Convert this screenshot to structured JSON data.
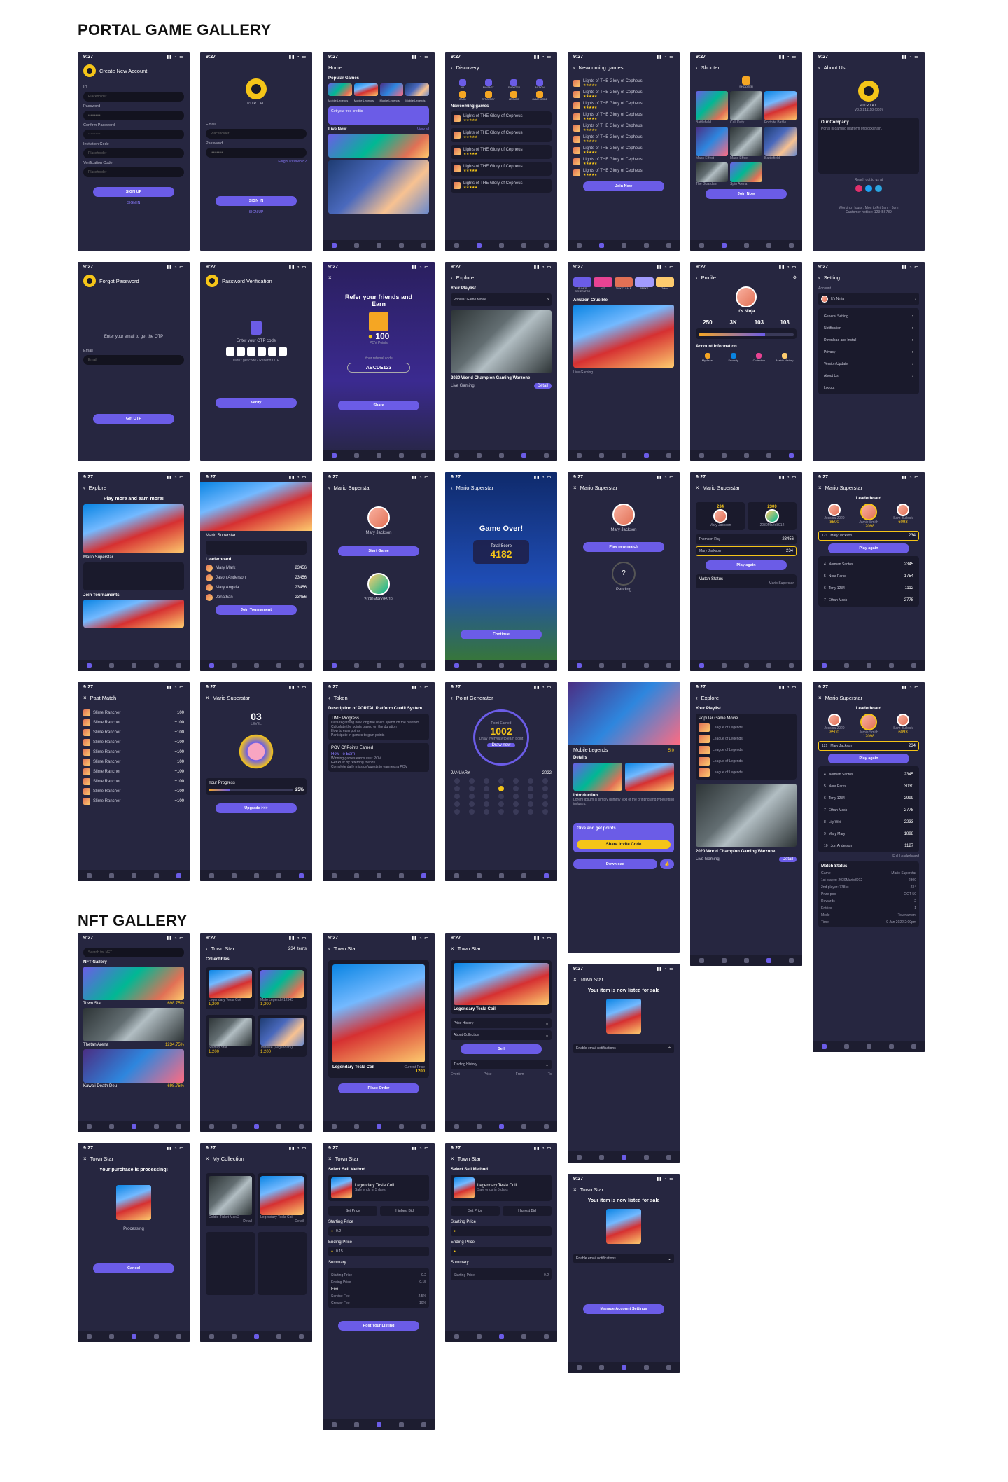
{
  "sections": {
    "game": "PORTAL GAME GALLERY",
    "nft": "NFT GALLERY"
  },
  "status": {
    "time": "9:27"
  },
  "common": {
    "portal": "PORTAL",
    "email": "Email",
    "password": "Password",
    "placeholder": "Placeholder",
    "sign_in": "SIGN IN",
    "sign_up": "SIGN UP",
    "join_now": "Join Now",
    "share": "Share"
  },
  "create_account": {
    "title": "Create New Account",
    "fields": [
      "ID",
      "Password",
      "Confirm Password",
      "Invitation Code",
      "Verification Code"
    ],
    "button": "SIGN UP",
    "link": "SIGN IN"
  },
  "login": {
    "forgot": "Forgot Password?",
    "button": "SIGN IN",
    "link": "SIGN UP"
  },
  "home": {
    "title": "Home",
    "popular": "Popular Games",
    "games": [
      "Mobile Legends",
      "Mobile Legends",
      "Mobile Legends",
      "Mobile Legends"
    ],
    "credits": "Get your free credits",
    "live": "Live Now",
    "view_all": "View all"
  },
  "discovery": {
    "title": "Discovery",
    "cats": [
      "ALL",
      "FANTASY",
      "SHOOTER",
      "ACTION",
      "CARD",
      "STRATEGY",
      "LEISURE",
      "GAME MODE"
    ],
    "newcoming": "Newcoming games",
    "game": "Lights of THE Glory of Cepheus"
  },
  "newcoming": {
    "title": "Newcoming games",
    "button": "Join Now"
  },
  "shooter": {
    "title": "Shooter",
    "label": "SHOOTER",
    "tiles": [
      "Battlefield",
      "Call Duty",
      "Fortnite Battle",
      "Mass Effect",
      "Mass Effect",
      "Battlefield",
      "The Guardian",
      "Spin Arena"
    ],
    "button": "Join Now"
  },
  "about": {
    "title": "About Us",
    "version": "V3.0.211118 (369)",
    "company": "Our Company",
    "reach": "Reach out to us at",
    "hours": "Working Hours : Mon to Fri  9am - 6pm",
    "hotline": "Customer hotline: 123456789"
  },
  "forgot": {
    "title": "Forgot Password",
    "text": "Enter your email to get the OTP",
    "button": "Get OTP"
  },
  "verify": {
    "title": "Password Verification",
    "text": "Enter your OTP code",
    "resend": "Didn't get code? Resend OTP",
    "button": "Verify"
  },
  "refer": {
    "title": "Refer your friends and Earn",
    "points": "100",
    "unit": "POV Points",
    "referral": "Your referral code",
    "code": "ABCDE123",
    "button": "Share"
  },
  "explore_a": {
    "title": "Explore",
    "playlist": "Your Playlist",
    "movie": "Popular Game Movie",
    "video": "2020 World Champion Gaming Warzone",
    "live": "Live Gaming",
    "detail": "Detail"
  },
  "portfolio": {
    "apps": [
      "PUNKS GENERATOR",
      "NFT",
      "TICKET SALE",
      "PERKS",
      "Token"
    ],
    "featured": "Amazon Crucible",
    "live": "Live Gaming"
  },
  "profile": {
    "title": "Profile",
    "name": "It's Ninja",
    "stats": [
      "250",
      "3K",
      "103",
      "103"
    ],
    "account": "Account Information",
    "items": [
      "My Asset",
      "Security",
      "Collection",
      "Match History"
    ]
  },
  "setting": {
    "title": "Setting",
    "account": "Account",
    "name": "It's Ninja",
    "items": [
      "General Setting",
      "Notification",
      "Download and Install",
      "Privacy",
      "Version Update",
      "About Us",
      "Logout"
    ]
  },
  "explore_b": {
    "title": "Explore",
    "headline": "Play more and earn more!",
    "game": "Mario Superstar",
    "tourn": "Join Tournaments"
  },
  "tournament": {
    "game": "Mario Superstar",
    "board": "Leaderboard",
    "players": [
      [
        "Mary Mark",
        "23456"
      ],
      [
        "Jason Anderson",
        "23456"
      ],
      [
        "Mary Angela",
        "23456"
      ],
      [
        "Jonathan",
        "23456"
      ]
    ],
    "button": "Join Tournament"
  },
  "match": {
    "game": "Mario Superstar",
    "player": "Mary Jackson",
    "button": "Start Game",
    "opponent": "2030Mario8912"
  },
  "gameover": {
    "game": "Mario Superstar",
    "title": "Game Over!",
    "label": "Total Score",
    "score": "4182",
    "button": "Continue"
  },
  "pending": {
    "game": "Mario Superstar",
    "player": "Mary Jackson",
    "button": "Play new match",
    "status": "Pending"
  },
  "result": {
    "game": "Mario Superstar",
    "s1": "234",
    "s2": "2300",
    "p1": "Mary Jackson",
    "p2": "2030Mario8912",
    "r1": "Thomson Ray",
    "r1s": "23456",
    "r2": "Mary Jackson",
    "r2s": "234",
    "button": "Play again",
    "status": "Match Status",
    "opp": "Mario Superstar"
  },
  "leader": {
    "game": "Mario Superstar",
    "title": "Leaderboard",
    "top": [
      [
        "Jessica 2020",
        "8500"
      ],
      [
        "Jamie Smith",
        "12098"
      ],
      [
        "Sam Bullock",
        "6093"
      ]
    ],
    "me": [
      "121",
      "Mary Jackson",
      "234"
    ],
    "button": "Play again",
    "rows": [
      [
        "4",
        "Norman Santos",
        "2345"
      ],
      [
        "5",
        "Nora Parks",
        "1754"
      ],
      [
        "6",
        "Tony 1234",
        "1112"
      ],
      [
        "7",
        "Ethan Mask",
        "2778"
      ]
    ]
  },
  "past": {
    "title": "Past Match",
    "game": "Slime Rancher",
    "reward": "+100"
  },
  "level": {
    "game": "Mario Superstar",
    "lvl": "03",
    "lvl_label": "LEVEL",
    "progress": "Your Progress",
    "pct": "25%",
    "pct_value": 25,
    "button": "Upgrade >>>"
  },
  "token": {
    "title": "Token",
    "desc": "Description of PORTAL Platform Credit System",
    "time": "TIME Progress",
    "points": [
      "Data regarding how long the users spend on the platform",
      "Calculate the points based on the duration",
      "How to earn points",
      "Participate in games to gain points"
    ],
    "pov": "POV Of Points Earned",
    "earn": "How To Earn",
    "steps": [
      "Winning games earns user POV",
      "Get POV by referring friends",
      "Complete daily mission/quests to earn extra POV"
    ]
  },
  "pointgen": {
    "title": "Point Generator",
    "label": "Point Earned",
    "value": "1002",
    "text": "Draw everyday to earn point",
    "button": "Draw now",
    "month": "JANUARY",
    "year": "2022"
  },
  "mlbb": {
    "title": "Mobile Legends",
    "rating": "5.0",
    "details": "Details",
    "intro": "Introduction",
    "promo": "Give and get points",
    "share": "Share Invite Code",
    "download": "Download"
  },
  "explore_c": {
    "title": "Explore",
    "playlist": "Your Playlist",
    "movie": "Popular Game Movie",
    "item": "League of Legends",
    "video": "2020 World Champion Gaming Warzone",
    "live": "Live Gaming",
    "detail": "Detail"
  },
  "leader_b": {
    "game": "Mario Superstar",
    "title": "Leaderboard",
    "rows": [
      [
        "4",
        "Norman Santos",
        "2345"
      ],
      [
        "5",
        "Nora Parks",
        "3030"
      ],
      [
        "6",
        "Tony 1234",
        "2999"
      ],
      [
        "7",
        "Ethan Mask",
        "2778"
      ],
      [
        "8",
        "Lily Wei",
        "2233"
      ],
      [
        "9",
        "Mary Mary",
        "1898"
      ],
      [
        "10",
        "Jon Anderson",
        "1127"
      ]
    ],
    "full": "Full Leaderboard",
    "status": "Match Status",
    "kv": [
      [
        "Game",
        "Mario Superstar"
      ],
      [
        "1st player: 2030Mario8912",
        "2300"
      ],
      [
        "2nd player: 778cc",
        "234"
      ],
      [
        "Prize pool",
        "GGT 50"
      ],
      [
        "Rewards",
        "2"
      ],
      [
        "Entries",
        "1"
      ],
      [
        "Mode",
        "Tournament"
      ],
      [
        "Time",
        "9 Jan 2022 2:00pm"
      ]
    ]
  },
  "nft_gallery": {
    "search": "Search for NFT",
    "label": "NFT Gallery",
    "items": [
      [
        "Town Star",
        "698.75%"
      ],
      [
        "Thetan Arena",
        "1234.75%"
      ],
      [
        "Kawaii Death Deu",
        "698.75%"
      ]
    ]
  },
  "collectibles": {
    "title": "Town Star",
    "count": "234 items",
    "label": "Collectibles",
    "items": [
      [
        "Legendary Tesla Coil",
        "1,200"
      ],
      [
        "Malo Legend #12345",
        "1,200"
      ],
      [
        "Startup Star",
        "1,200"
      ],
      [
        "Tortoise (Legendary)",
        "1,200"
      ]
    ]
  },
  "nft_detail": {
    "title": "Town Star",
    "name": "Legendary Tesla Coil",
    "price_label": "Current Price",
    "price": "1200",
    "button": "Place Order"
  },
  "nft_sell": {
    "title": "Town Star",
    "name": "Legendary Tesla Coil",
    "items": [
      "Price History",
      "About Collection"
    ],
    "button": "Sell",
    "trading": "Trading History",
    "cols": [
      "Event",
      "Price",
      "From",
      "To"
    ]
  },
  "listed_a": {
    "title": "Town Star",
    "msg": "Your item is now listed for sale",
    "notif": "Enable email notifications"
  },
  "processing": {
    "title": "Town Star",
    "msg": "Your purchase is processing!",
    "status": "Processing",
    "button": "Cancel"
  },
  "mycollection": {
    "title": "My Collection",
    "items": [
      "Goldie Ticket Max 2",
      "Legendary Tesla Coil"
    ],
    "detail": "Detail"
  },
  "sellmethod": {
    "title": "Town Star",
    "label": "Select Sell Method",
    "name": "Legendary Tesla Coil",
    "ends": "Sale ends in 5 days",
    "opts": [
      "Set Price",
      "Highest Bid"
    ],
    "start": "Starting Price",
    "end": "Ending Price",
    "v1": "0.2",
    "v2": "0.15",
    "summary": "Summary",
    "fee": "Fee",
    "service": "Service Fee",
    "service_v": "2.5%",
    "creator": "Creator Fee",
    "creator_v": "10%",
    "button": "Post Your Listing"
  },
  "listed_b": {
    "title": "Town Star",
    "msg": "Your item is now listed for sale",
    "notif": "Enable email notifications",
    "button": "Manage Account Settings"
  },
  "colors": {
    "bg": "#262640",
    "panel": "#1a1a2c",
    "accent": "#6b5ce7",
    "gold": "#f5c518"
  }
}
